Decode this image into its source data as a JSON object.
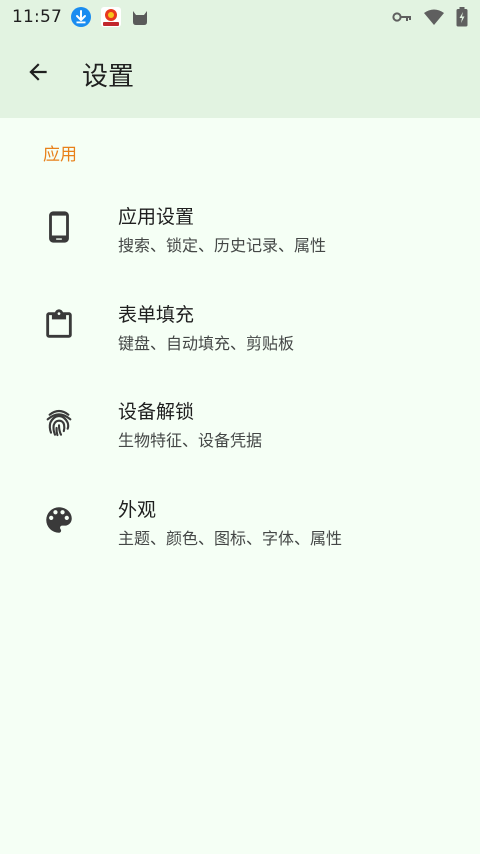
{
  "status_bar": {
    "time": "11:57",
    "icons": [
      "download-icon",
      "app-badge-icon",
      "cat-icon",
      "key-icon",
      "wifi-icon",
      "battery-icon"
    ]
  },
  "app_bar": {
    "title": "设置",
    "back_icon": "arrow-back-icon"
  },
  "section": {
    "header": "应用"
  },
  "items": [
    {
      "icon": "phone-icon",
      "title": "应用设置",
      "subtitle": "搜索、锁定、历史记录、属性"
    },
    {
      "icon": "clipboard-icon",
      "title": "表单填充",
      "subtitle": "键盘、自动填充、剪贴板"
    },
    {
      "icon": "fingerprint-icon",
      "title": "设备解锁",
      "subtitle": "生物特征、设备凭据"
    },
    {
      "icon": "palette-icon",
      "title": "外观",
      "subtitle": "主题、颜色、图标、字体、属性"
    }
  ],
  "colors": {
    "app_bar_bg": "#e2f3e1",
    "page_bg": "#f5fff5",
    "section_accent": "#e8801a",
    "text_primary": "#1f1f1f",
    "text_secondary": "#444746"
  }
}
